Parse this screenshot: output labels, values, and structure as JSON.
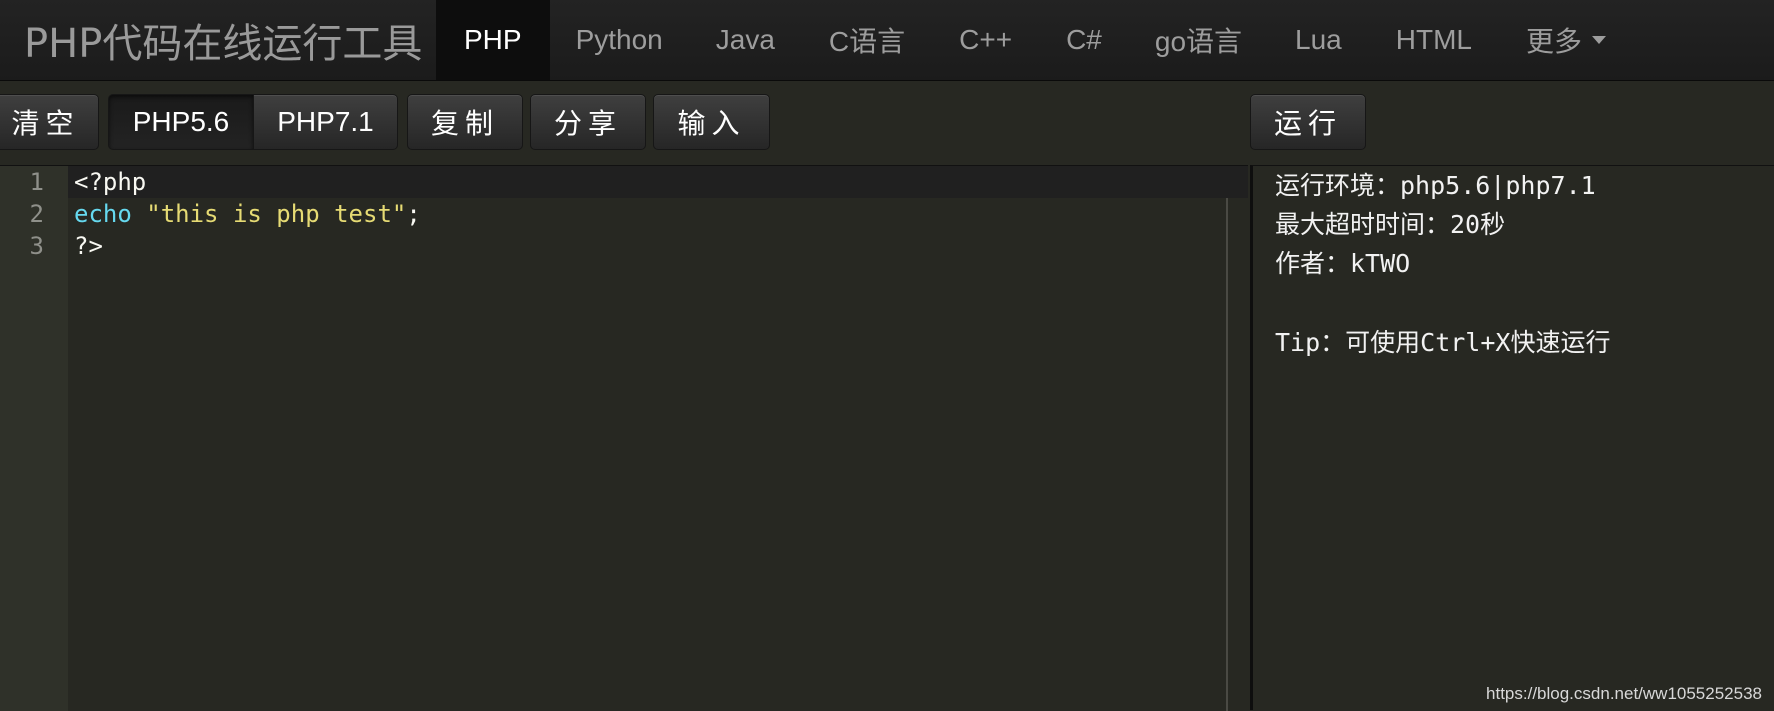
{
  "header": {
    "brand": "PHP代码在线运行工具",
    "nav": [
      {
        "label": "PHP",
        "active": true
      },
      {
        "label": "Python"
      },
      {
        "label": "Java"
      },
      {
        "label": "C语言"
      },
      {
        "label": "C++"
      },
      {
        "label": "C#"
      },
      {
        "label": "go语言"
      },
      {
        "label": "Lua"
      },
      {
        "label": "HTML"
      },
      {
        "label": "更多"
      }
    ]
  },
  "toolbar": {
    "clear_label": "清空",
    "php56_label": "PHP5.6",
    "php71_label": "PHP7.1",
    "copy_label": "复制",
    "share_label": "分享",
    "input_label": "输入",
    "run_label": "运行",
    "selected_version": "PHP5.6"
  },
  "editor": {
    "line_numbers": [
      "1",
      "2",
      "3"
    ],
    "lines": {
      "l1": "<?php",
      "l2_keyword": "echo",
      "l2_space": " ",
      "l2_string": "\"this is php test\"",
      "l2_end": ";",
      "l3": "?>"
    }
  },
  "output": {
    "lines": [
      "运行环境：php5.6|php7.1",
      "最大超时时间：20秒",
      "作者：kTWO",
      "Tip：可使用Ctrl+X快速运行"
    ]
  },
  "watermark": "https://blog.csdn.net/ww1055252538",
  "colors": {
    "background": "#272822",
    "keyword": "#66d9ef",
    "string": "#e6db74",
    "nav_active_bg": "#0d0d0d"
  }
}
